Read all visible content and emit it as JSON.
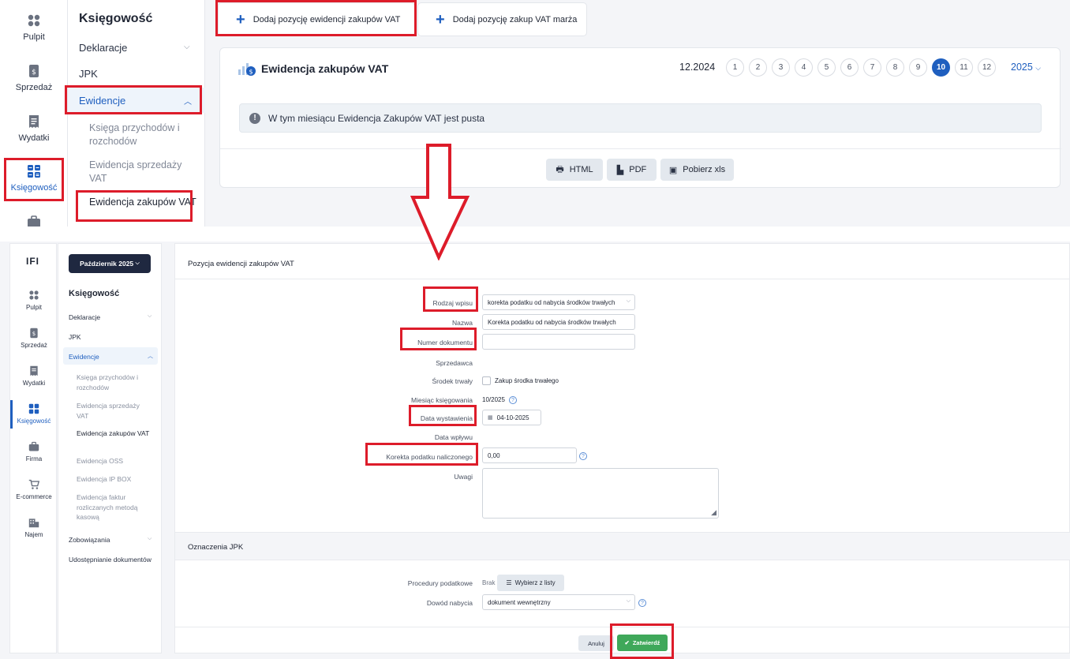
{
  "top": {
    "rail": [
      {
        "label": "Pulpit",
        "icon": "dashboard-icon"
      },
      {
        "label": "Sprzedaż",
        "icon": "invoice-icon"
      },
      {
        "label": "Wydatki",
        "icon": "receipt-icon"
      },
      {
        "label": "Księgowość",
        "icon": "calculator-icon"
      }
    ],
    "menu": {
      "title": "Księgowość",
      "deklaracje": "Deklaracje",
      "jpk": "JPK",
      "ewidencje": "Ewidencje",
      "sub": [
        "Księga przychodów i rozchodów",
        "Ewidencja sprzedaży VAT",
        "Ewidencja zakupów VAT"
      ]
    },
    "buttons": {
      "add_purchase": "Dodaj pozycję ewidencji zakupów VAT",
      "add_margin": "Dodaj pozycję zakup VAT marża"
    },
    "card": {
      "title": "Ewidencja zakupów VAT",
      "month": "12.2024",
      "pages": [
        "1",
        "2",
        "3",
        "4",
        "5",
        "6",
        "7",
        "8",
        "9",
        "10",
        "11",
        "12"
      ],
      "active_page": "10",
      "year": "2025",
      "info": "W tym miesiącu Ewidencja Zakupów VAT jest pusta",
      "export": {
        "html": "HTML",
        "pdf": "PDF",
        "xls": "Pobierz xls"
      }
    }
  },
  "bottom": {
    "logo": "IFI",
    "month_button": "Październik 2025",
    "rail": [
      {
        "label": "Pulpit"
      },
      {
        "label": "Sprzedaż"
      },
      {
        "label": "Wydatki"
      },
      {
        "label": "Księgowość"
      },
      {
        "label": "Firma"
      },
      {
        "label": "E-commerce"
      },
      {
        "label": "Najem"
      }
    ],
    "menu": {
      "title": "Księgowość",
      "deklaracje": "Deklaracje",
      "jpk": "JPK",
      "ewidencje": "Ewidencje",
      "sub": [
        "Księga przychodów i rozchodów",
        "Ewidencja sprzedaży VAT",
        "Ewidencja zakupów VAT",
        "Ewidencja OSS",
        "Ewidencja IP BOX",
        "Ewidencja faktur rozliczanych metodą kasową"
      ],
      "zobowiazania": "Zobowiązania",
      "udostepnianie": "Udostępnianie dokumentów"
    },
    "form": {
      "header": "Pozycja ewidencji zakupów VAT",
      "rodzaj_label": "Rodzaj wpisu",
      "rodzaj_value": "korekta podatku od nabycia środków trwałych",
      "nazwa_label": "Nazwa",
      "nazwa_value": "Korekta podatku od nabycia środków trwałych",
      "numer_label": "Numer dokumentu",
      "numer_value": "",
      "sprzedawca_label": "Sprzedawca",
      "srodek_label": "Środek trwały",
      "srodek_checkbox": "Zakup środka trwałego",
      "miesiac_label": "Miesiąc księgowania",
      "miesiac_value": "10/2025",
      "data_wyst_label": "Data wystawienia",
      "data_wyst_value": "04-10-2025",
      "data_wplywu_label": "Data wpływu",
      "korekta_label": "Korekta podatku naliczonego",
      "korekta_value": "0,00",
      "uwagi_label": "Uwagi",
      "jpk_header": "Oznaczenia JPK",
      "procedury_label": "Procedury podatkowe",
      "procedury_value": "Brak",
      "wybierz_label": "Wybierz z listy",
      "dowod_label": "Dowód nabycia",
      "dowod_value": "dokument wewnętrzny",
      "cancel": "Anuluj",
      "submit": "Zatwierdź"
    }
  },
  "colors": {
    "highlight": "#dd1c2a",
    "accent": "#1f5fbf",
    "success": "#3fa85a",
    "navy": "#1f2840"
  }
}
